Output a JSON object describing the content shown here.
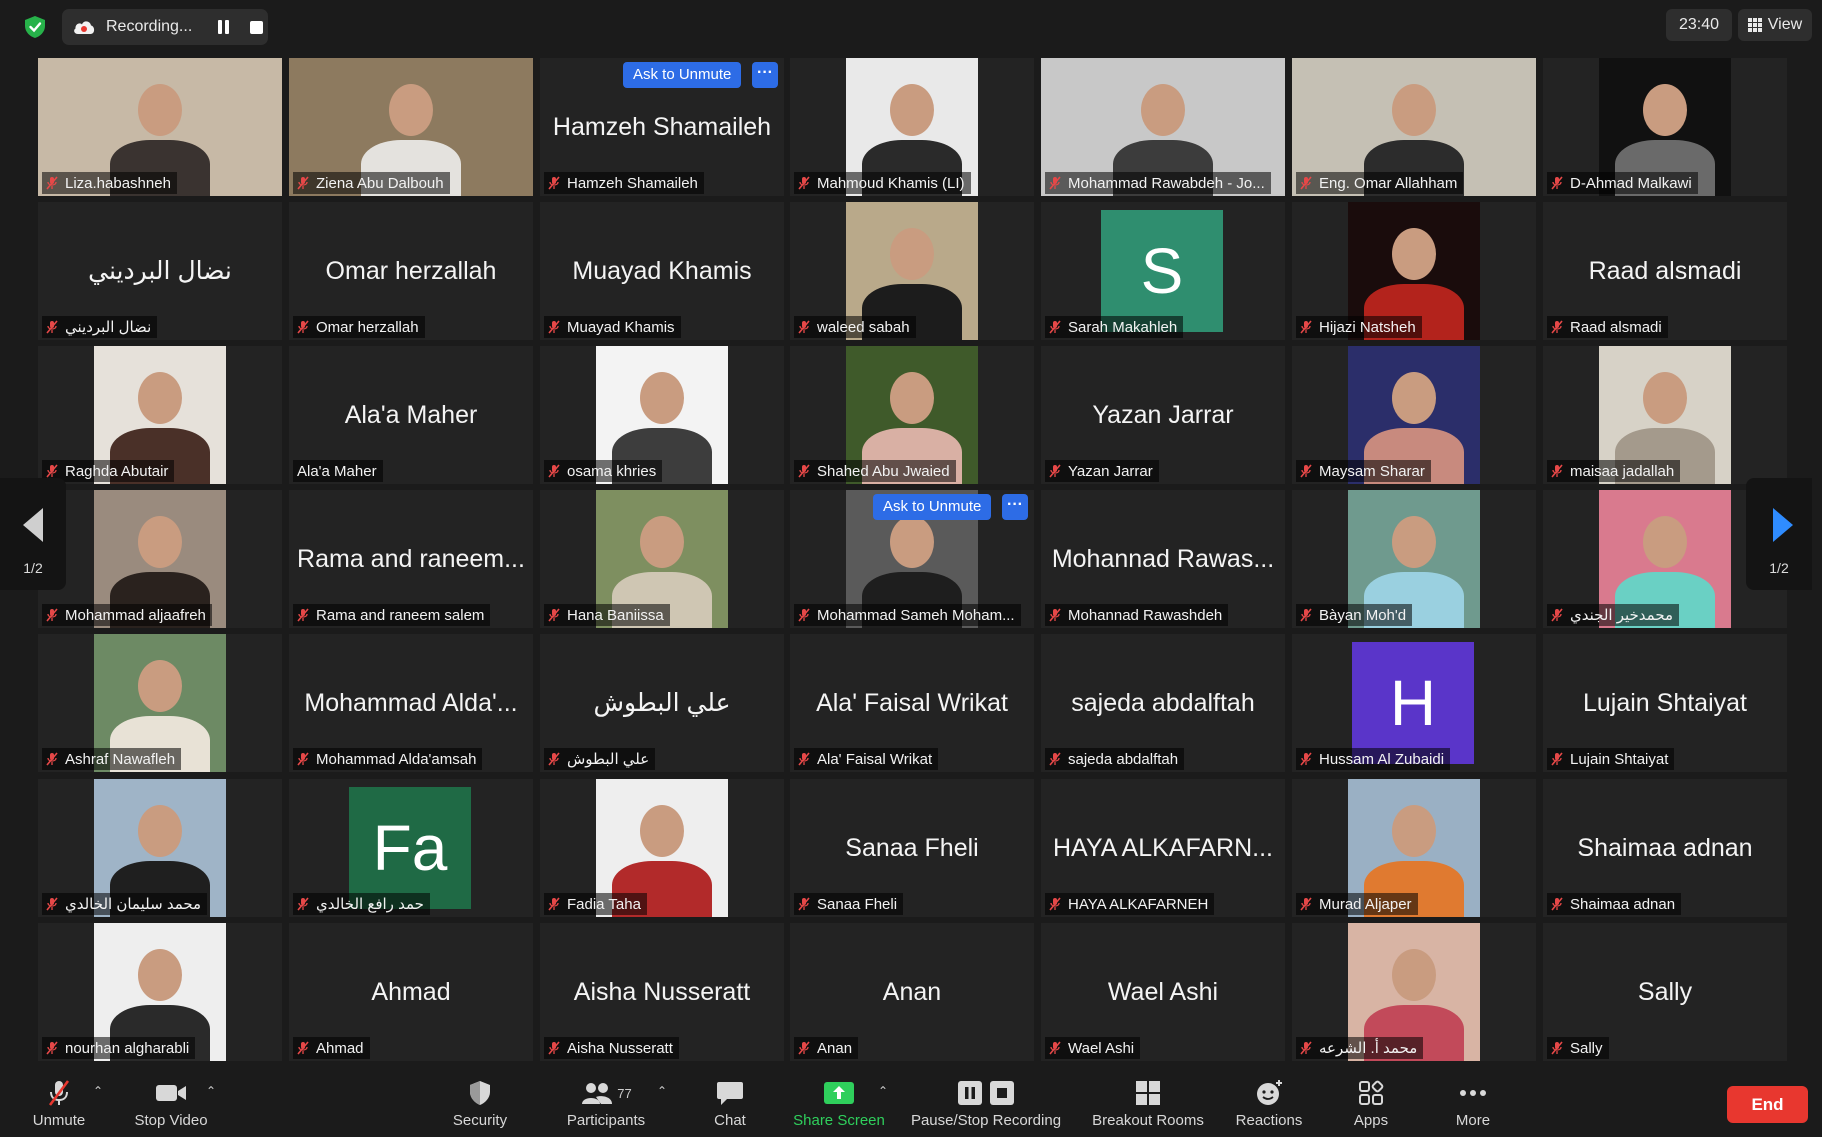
{
  "topbar": {
    "recording_label": "Recording...",
    "clock": "23:40",
    "view_label": "View"
  },
  "pager": {
    "left_page": "1/2",
    "right_page": "1/2"
  },
  "ask_to_unmute": "Ask to Unmute",
  "more_dots": "···",
  "participants": [
    {
      "name": "Liza.habashneh",
      "video": true,
      "colors": [
        "#c7b9a6",
        "#3a3330"
      ]
    },
    {
      "name": "Ziena Abu Dalbouh",
      "video": true,
      "colors": [
        "#8d7a5f",
        "#e4e2de"
      ]
    },
    {
      "name": "Hamzeh Shamaileh",
      "display": "Hamzeh Shamaileh",
      "ask": true
    },
    {
      "name": "Mahmoud Khamis (LI)",
      "video": true,
      "mid": true,
      "colors": [
        "#e9e9e9",
        "#2a2a2a"
      ]
    },
    {
      "name": "Mohammad Rawabdeh - Jo...",
      "video": true,
      "colors": [
        "#c8c8c8",
        "#3c3c3c"
      ]
    },
    {
      "name": "Eng. Omar Allahham",
      "video": true,
      "active": true,
      "colors": [
        "#c5c0b4",
        "#2c2c2c"
      ]
    },
    {
      "name": "D-Ahmad Malkawi",
      "video": true,
      "mid": true,
      "colors": [
        "#111111",
        "#6a6a6a"
      ]
    },
    {
      "name": "نضال البرديني",
      "display": "نضال البرديني"
    },
    {
      "name": "Omar herzallah",
      "display": "Omar herzallah"
    },
    {
      "name": "Muayad Khamis",
      "display": "Muayad Khamis"
    },
    {
      "name": "waleed sabah",
      "video": true,
      "mid": true,
      "colors": [
        "#b9a98a",
        "#1c1c1c"
      ]
    },
    {
      "name": "Sarah Makahleh",
      "avatar": "S",
      "avatar_color": "#2f8e6f"
    },
    {
      "name": "Hijazi Natsheh",
      "video": true,
      "mid": true,
      "colors": [
        "#1a0c0c",
        "#b3231c"
      ]
    },
    {
      "name": "Raad alsmadi",
      "display": "Raad alsmadi"
    },
    {
      "name": "Raghda Abutair",
      "video": true,
      "mid": true,
      "colors": [
        "#e6e1da",
        "#4a3028"
      ]
    },
    {
      "name": "Ala'a Maher",
      "display": "Ala'a Maher",
      "no_mic": true
    },
    {
      "name": "osama khries",
      "video": true,
      "mid": true,
      "colors": [
        "#f3f3f3",
        "#3d3d3d"
      ]
    },
    {
      "name": "Shahed Abu Jwaied",
      "video": true,
      "mid": true,
      "colors": [
        "#3f5a2a",
        "#d9b0a4"
      ]
    },
    {
      "name": "Yazan Jarrar",
      "display": "Yazan Jarrar"
    },
    {
      "name": "Maysam Sharar",
      "video": true,
      "mid": true,
      "colors": [
        "#2b2e6a",
        "#c88a7e"
      ]
    },
    {
      "name": "maisaa jadallah",
      "video": true,
      "mid": true,
      "colors": [
        "#d7d2c7",
        "#a49a8c"
      ]
    },
    {
      "name": "Mohammad aljaafreh",
      "video": true,
      "mid": true,
      "colors": [
        "#9a8b7e",
        "#2a221e"
      ]
    },
    {
      "name": "Rama and raneem salem",
      "display": "Rama and raneem..."
    },
    {
      "name": "Hana Baniissa",
      "video": true,
      "mid": true,
      "colors": [
        "#7e8f60",
        "#cfc6b3"
      ]
    },
    {
      "name": "Mohammad Sameh Moham...",
      "video": true,
      "mid": true,
      "ask": true,
      "colors": [
        "#5a5a5a",
        "#1e1e1e"
      ]
    },
    {
      "name": "Mohannad Rawashdeh",
      "display": "Mohannad Rawas..."
    },
    {
      "name": "Bàyan Moh'd",
      "video": true,
      "mid": true,
      "colors": [
        "#6f9a8e",
        "#9ad0e0"
      ]
    },
    {
      "name": "محمدخير الجندي",
      "video": true,
      "mid": true,
      "colors": [
        "#d97a8e",
        "#6ad0c4"
      ]
    },
    {
      "name": "Ashraf Nawafleh",
      "video": true,
      "mid": true,
      "colors": [
        "#6d8a64",
        "#e8e2d6"
      ]
    },
    {
      "name": "Mohammad Alda'amsah",
      "display": "Mohammad Alda'..."
    },
    {
      "name": "علي البطوش",
      "display": "علي البطوش"
    },
    {
      "name": "Ala' Faisal Wrikat",
      "display": "Ala' Faisal Wrikat"
    },
    {
      "name": "sajeda abdalftah",
      "display": "sajeda abdalftah"
    },
    {
      "name": "Hussam Al Zubaidi",
      "avatar": "H",
      "avatar_color": "#5a35c9"
    },
    {
      "name": "Lujain Shtaiyat",
      "display": "Lujain Shtaiyat"
    },
    {
      "name": "محمد سليمان الخالدي",
      "video": true,
      "mid": true,
      "colors": [
        "#9fb4c7",
        "#1f1f1f"
      ]
    },
    {
      "name": "حمد رافع الخالدي",
      "avatar": "Fa",
      "avatar_color": "#1f6a45"
    },
    {
      "name": "Fadia Taha",
      "video": true,
      "mid": true,
      "colors": [
        "#eeeeee",
        "#b22a2a"
      ]
    },
    {
      "name": "Sanaa Fheli",
      "display": "Sanaa Fheli"
    },
    {
      "name": "HAYA ALKAFARNEH",
      "display": "HAYA ALKAFARN..."
    },
    {
      "name": "Murad Aljaper",
      "video": true,
      "mid": true,
      "colors": [
        "#9ab0c4",
        "#e07a30"
      ]
    },
    {
      "name": "Shaimaa  adnan",
      "display": "Shaimaa  adnan"
    },
    {
      "name": "nourhan algharabli",
      "video": true,
      "mid": true,
      "colors": [
        "#eeeeee",
        "#2a2a2a"
      ]
    },
    {
      "name": "Ahmad",
      "display": "Ahmad"
    },
    {
      "name": "Aisha Nusseratt",
      "display": "Aisha Nusseratt"
    },
    {
      "name": "Anan",
      "display": "Anan"
    },
    {
      "name": "Wael Ashi",
      "display": "Wael Ashi"
    },
    {
      "name": "محمد أ. الشرعه",
      "video": true,
      "mid": true,
      "colors": [
        "#d8b4a4",
        "#c24a5a"
      ]
    },
    {
      "name": "Sally",
      "display": "Sally"
    }
  ],
  "toolbar": {
    "unmute": "Unmute",
    "stop_video": "Stop Video",
    "security": "Security",
    "participants": "Participants",
    "participants_count": "77",
    "chat": "Chat",
    "share_screen": "Share Screen",
    "pause_stop_recording": "Pause/Stop Recording",
    "breakout_rooms": "Breakout Rooms",
    "reactions": "Reactions",
    "apps": "Apps",
    "more": "More",
    "end": "End",
    "share_color": "#2fcf5c",
    "end_color": "#e8372f",
    "active_speaker_color": "#d6e272"
  }
}
